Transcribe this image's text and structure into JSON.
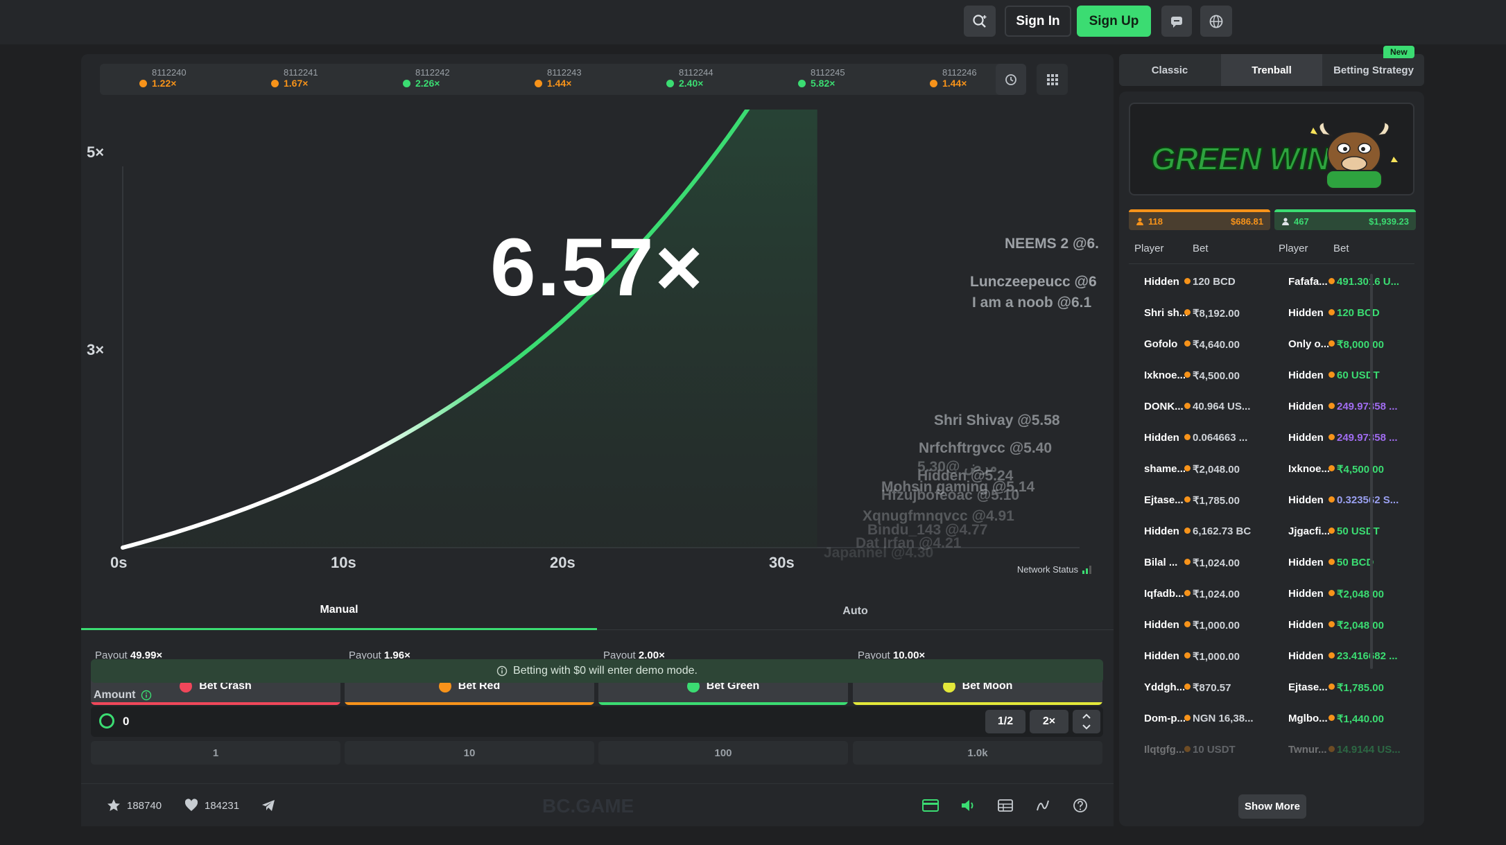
{
  "header": {
    "signin_label": "Sign In",
    "signup_label": "Sign Up"
  },
  "history": [
    {
      "id": "8112240",
      "value": "1.22×",
      "color": "#f7931a"
    },
    {
      "id": "8112241",
      "value": "1.67×",
      "color": "#f7931a"
    },
    {
      "id": "8112242",
      "value": "2.26×",
      "color": "#3bdc72"
    },
    {
      "id": "8112243",
      "value": "1.44×",
      "color": "#f7931a"
    },
    {
      "id": "8112244",
      "value": "2.40×",
      "color": "#3bdc72"
    },
    {
      "id": "8112245",
      "value": "5.82×",
      "color": "#3bdc72"
    },
    {
      "id": "8112246",
      "value": "1.44×",
      "color": "#f7931a"
    }
  ],
  "game": {
    "multiplier": "6.57×",
    "network_status": "Network Status",
    "y_ticks": [
      "5×",
      "3×"
    ],
    "x_ticks": [
      "0s",
      "10s",
      "20s",
      "30s"
    ],
    "cashouts": [
      "NEEMS 2 @6.",
      "Lunczeepeucc @6",
      "I am a noob @6.1",
      "Shri Shivay @5.58",
      "Nrfchftrgvcc @5.40",
      "5.30@ مرض",
      "Hidden @5.24",
      "Mohsin gaming @5.14",
      "Hfzujbofeoac @5.10",
      "Xqnugfmnqvcc @4.91",
      "Bindu_143 @4.77",
      "Dat Irfan @4.21",
      "Japannel @4.30"
    ]
  },
  "chart_data": {
    "type": "line",
    "title": "",
    "xlabel": "",
    "ylabel": "",
    "x_ticks": [
      "0s",
      "10s",
      "20s",
      "30s"
    ],
    "y_ticks": [
      "3×",
      "5×"
    ],
    "series": [
      {
        "x": [
          0,
          5,
          10,
          15,
          20,
          25,
          30,
          31.7
        ],
        "y": [
          1.0,
          1.35,
          1.82,
          2.45,
          3.3,
          4.45,
          6.0,
          6.57
        ]
      }
    ]
  },
  "modes": {
    "manual": "Manual",
    "auto": "Auto"
  },
  "bets": [
    {
      "payout_label": "Payout",
      "payout": "49.99×",
      "label": "Bet Crash",
      "color": "#f0475a"
    },
    {
      "payout_label": "Payout",
      "payout": "1.96×",
      "label": "Bet Red",
      "color": "#f7931a"
    },
    {
      "payout_label": "Payout",
      "payout": "2.00×",
      "label": "Bet Green",
      "color": "#3bdc72"
    },
    {
      "payout_label": "Payout",
      "payout": "10.00×",
      "label": "Bet Moon",
      "color": "#e3e83a"
    }
  ],
  "demo_note": "Betting with $0 will enter demo mode.",
  "amount": {
    "label": "Amount",
    "value": "0",
    "half": "1/2",
    "double": "2×",
    "quick": [
      "1",
      "10",
      "100",
      "1.0k"
    ]
  },
  "footer": {
    "favorites": "188740",
    "likes": "184231",
    "brand": "BC.GAME"
  },
  "right": {
    "tabs": [
      "Classic",
      "Trenball",
      "Betting Strategy"
    ],
    "new_badge": "New",
    "banner_text": "GREEN WIN",
    "red_team": {
      "players": "118",
      "total": "$686.81"
    },
    "green_team": {
      "players": "467",
      "total": "$1,939.23"
    },
    "col_player": "Player",
    "col_bet": "Bet",
    "rows": [
      [
        "Hidden",
        "120 BCD",
        "Fafafa...",
        "491.3016 U..."
      ],
      [
        "Shri sh...",
        "₹8,192.00",
        "Hidden",
        "120 BCD"
      ],
      [
        "Gofolo",
        "₹4,640.00",
        "Only o...",
        "₹8,000.00"
      ],
      [
        "Ixknoe...",
        "₹4,500.00",
        "Hidden",
        "60 USDT"
      ],
      [
        "DONK...",
        "40.964 US...",
        "Hidden",
        "249.97358 ..."
      ],
      [
        "Hidden",
        "0.064663 ...",
        "Hidden",
        "249.97358 ..."
      ],
      [
        "shame...",
        "₹2,048.00",
        "Ixknoe...",
        "₹4,500.00"
      ],
      [
        "Ejtase...",
        "₹1,785.00",
        "Hidden",
        "0.323562 S..."
      ],
      [
        "Hidden",
        "6,162.73 BC",
        "Jjgacfi...",
        "50 USDT"
      ],
      [
        "Bilal ...",
        "₹1,024.00",
        "Hidden",
        "50 BCD"
      ],
      [
        "Iqfadb...",
        "₹1,024.00",
        "Hidden",
        "₹2,048.00"
      ],
      [
        "Hidden",
        "₹1,000.00",
        "Hidden",
        "₹2,048.00"
      ],
      [
        "Hidden",
        "₹1,000.00",
        "Hidden",
        "23.416682 ..."
      ],
      [
        "Yddgh...",
        "₹870.57",
        "Ejtase...",
        "₹1,785.00"
      ],
      [
        "Dom-p...",
        "NGN 16,38...",
        "Mglbo...",
        "₹1,440.00"
      ],
      [
        "Ilqtgfg...",
        "10 USDT",
        "Twnur...",
        "14.9144 US..."
      ]
    ],
    "show_more": "Show More"
  }
}
